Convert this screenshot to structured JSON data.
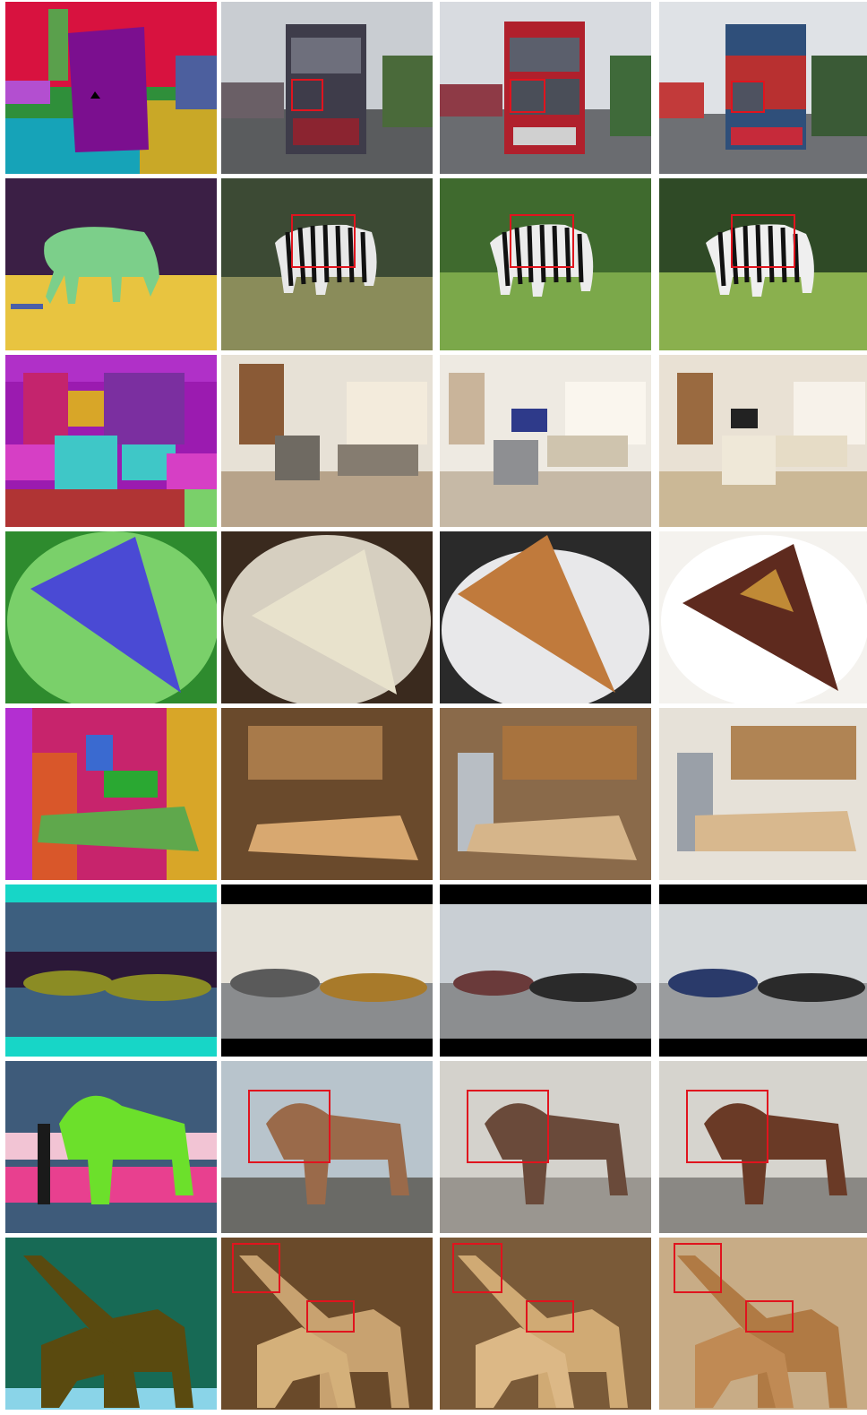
{
  "rows": [
    {
      "id": "bus",
      "label_map_colors": [
        "#d8123f",
        "#7b0f8f",
        "#c9a827",
        "#16a3b8",
        "#2f8f3a"
      ],
      "highlight": true
    },
    {
      "id": "zebra",
      "label_map_colors": [
        "#3b1f45",
        "#e8c440",
        "#7ccf8a"
      ],
      "highlight": true
    },
    {
      "id": "living-room",
      "label_map_colors": [
        "#9b1bb0",
        "#c4246d",
        "#3fc7c7",
        "#1fb07e",
        "#d63fc5"
      ],
      "highlight": false
    },
    {
      "id": "cake",
      "label_map_colors": [
        "#2e8b2e",
        "#7ad06a",
        "#4a4ad4"
      ],
      "highlight": false
    },
    {
      "id": "kitchen",
      "label_map_colors": [
        "#c7246c",
        "#b32fd1",
        "#d8a628",
        "#5fa84c",
        "#2aa832"
      ],
      "highlight": false
    },
    {
      "id": "motorcycles",
      "label_map_colors": [
        "#17d6c7",
        "#3d5f7f",
        "#8b8c24",
        "#2b1838"
      ],
      "highlight": false
    },
    {
      "id": "horses",
      "label_map_colors": [
        "#3e5b7a",
        "#6ce02b",
        "#e8408f",
        "#1a1a1a",
        "#f2c4d4"
      ],
      "highlight": true
    },
    {
      "id": "giraffes",
      "label_map_colors": [
        "#176a55",
        "#5a4a0f",
        "#8ad4e8"
      ],
      "highlight": true
    }
  ],
  "columns": [
    "semantic-label-map",
    "result-a",
    "result-b",
    "result-c"
  ],
  "highlight_color": "#e0141e"
}
